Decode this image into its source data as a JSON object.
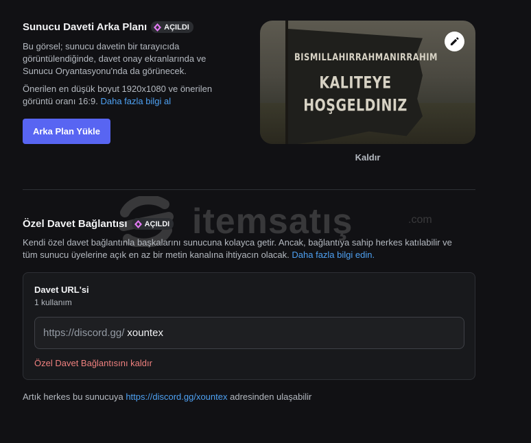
{
  "background_section": {
    "title": "Sunucu Daveti Arka Planı",
    "badge": "AÇILDI",
    "description_line1": "Bu görsel; sunucu davetin bir tarayıcıda",
    "description_line2": "görüntülendiğinde, davet onay ekranlarında ve",
    "description_line3": "Sunucu Oryantasyonu'nda da görünecek.",
    "size_line1": "Önerilen en düşük boyut 1920x1080 ve önerilen",
    "size_line2": "görüntü oranı 16:9.",
    "learn_more": "Daha fazla bilgi al",
    "upload_button": "Arka Plan Yükle",
    "remove_label": "Kaldır",
    "banner_lines": [
      "BISMILLAHIRRAHMANIRRAHIM",
      "KALITEYE",
      "HOŞGELDINIZ"
    ]
  },
  "watermark": {
    "text": "itemsatış",
    "suffix": ".com"
  },
  "invite_section": {
    "title": "Özel Davet Bağlantısı",
    "badge": "AÇILDI",
    "description_line1": "Kendi özel davet bağlantınla başkalarını sunucuna kolayca getir. Ancak, bağlantıya sahip herkes katılabilir ve",
    "description_line2": "tüm sunucu üyelerine açık en az bir metin kanalına ihtiyacın olacak.",
    "learn_more": "Daha fazla bilgi edin.",
    "card_title": "Davet URL'si",
    "usage": "1 kullanım",
    "url_prefix": "https://discord.gg/",
    "url_value": "xountex",
    "remove_link": "Özel Davet Bağlantısını kaldır"
  },
  "footer": {
    "before": "Artık herkes bu sunucuya",
    "link": "https://discord.gg/xountex",
    "after": "adresinden ulaşabilir"
  },
  "colors": {
    "background": "#111114",
    "accent": "#5865f2",
    "link": "#4ea1f3",
    "danger": "#f0817f",
    "nitro_gem": "#e27af3"
  }
}
